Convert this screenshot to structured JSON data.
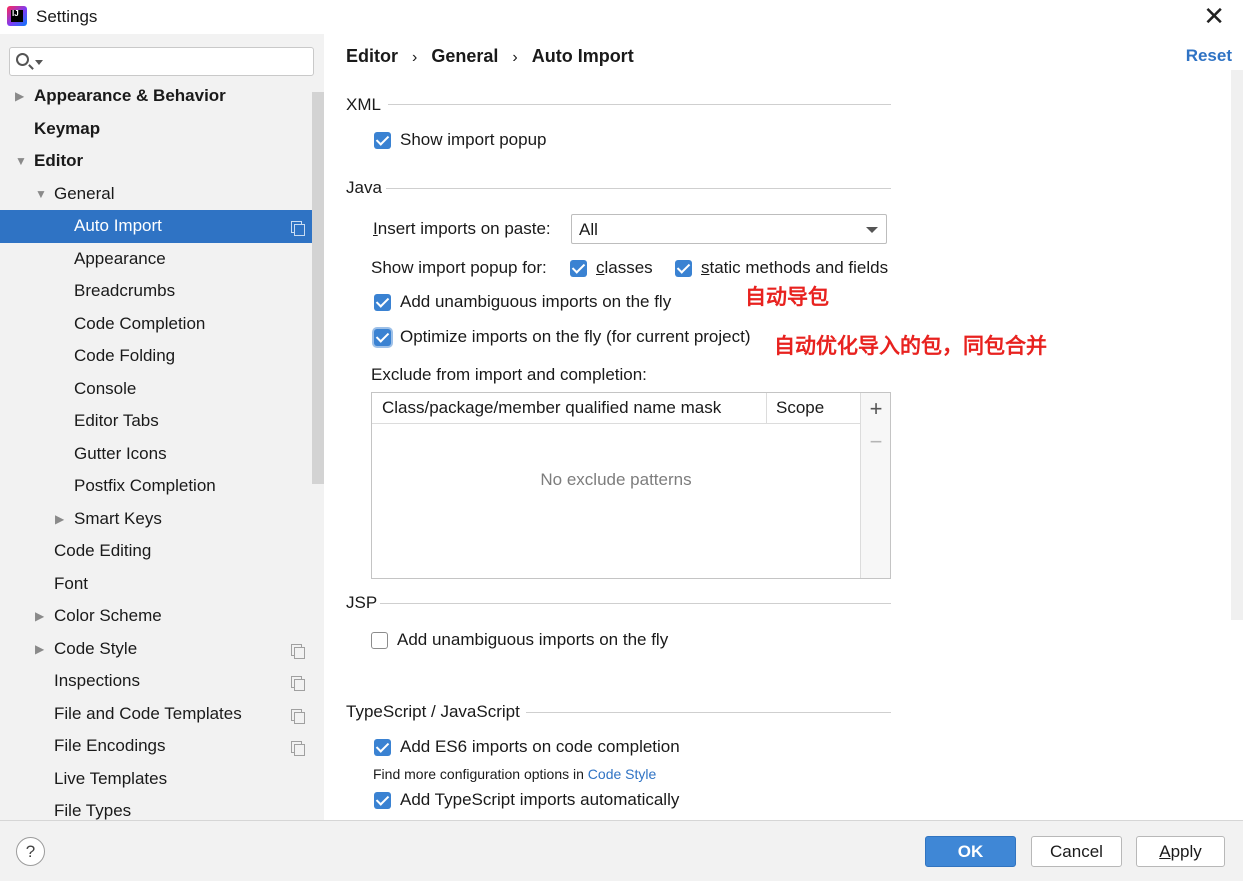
{
  "window": {
    "title": "Settings",
    "app_icon": "intellij-idea-icon",
    "close_glyph": "✕"
  },
  "search": {
    "value": "",
    "placeholder": ""
  },
  "sidebar": {
    "items": [
      {
        "label": "Appearance & Behavior",
        "level": 0,
        "arrow": "collapsed",
        "bold": true
      },
      {
        "label": "Keymap",
        "level": 0,
        "arrow": "none",
        "bold": true
      },
      {
        "label": "Editor",
        "level": 0,
        "arrow": "expanded",
        "bold": true
      },
      {
        "label": "General",
        "level": 1,
        "arrow": "expanded"
      },
      {
        "label": "Auto Import",
        "level": 2,
        "arrow": "none",
        "selected": true,
        "copy_icon": true
      },
      {
        "label": "Appearance",
        "level": 2,
        "arrow": "none"
      },
      {
        "label": "Breadcrumbs",
        "level": 2,
        "arrow": "none"
      },
      {
        "label": "Code Completion",
        "level": 2,
        "arrow": "none"
      },
      {
        "label": "Code Folding",
        "level": 2,
        "arrow": "none"
      },
      {
        "label": "Console",
        "level": 2,
        "arrow": "none"
      },
      {
        "label": "Editor Tabs",
        "level": 2,
        "arrow": "none"
      },
      {
        "label": "Gutter Icons",
        "level": 2,
        "arrow": "none"
      },
      {
        "label": "Postfix Completion",
        "level": 2,
        "arrow": "none"
      },
      {
        "label": "Smart Keys",
        "level": 2,
        "arrow": "collapsed"
      },
      {
        "label": "Code Editing",
        "level": 1,
        "arrow": "none"
      },
      {
        "label": "Font",
        "level": 1,
        "arrow": "none"
      },
      {
        "label": "Color Scheme",
        "level": 1,
        "arrow": "collapsed"
      },
      {
        "label": "Code Style",
        "level": 1,
        "arrow": "collapsed",
        "copy_icon": true
      },
      {
        "label": "Inspections",
        "level": 1,
        "arrow": "none",
        "copy_icon": true
      },
      {
        "label": "File and Code Templates",
        "level": 1,
        "arrow": "none",
        "copy_icon": true
      },
      {
        "label": "File Encodings",
        "level": 1,
        "arrow": "none",
        "copy_icon": true
      },
      {
        "label": "Live Templates",
        "level": 1,
        "arrow": "none"
      },
      {
        "label": "File Types",
        "level": 1,
        "arrow": "none"
      }
    ]
  },
  "breadcrumb": {
    "items": [
      "Editor",
      "General",
      "Auto Import"
    ],
    "separator": "›"
  },
  "reset_label": "Reset",
  "xml": {
    "title": "XML",
    "show_import_popup": {
      "label": "Show import popup",
      "checked": true
    }
  },
  "java": {
    "title": "Java",
    "insert_on_paste": {
      "label_prefix": "",
      "label_u": "I",
      "label_rest": "nsert imports on paste:",
      "value": "All"
    },
    "popup_for": {
      "label": "Show import popup for:",
      "classes": {
        "label_u": "c",
        "label_rest": "lasses",
        "checked": true
      },
      "static": {
        "label_u": "s",
        "label_rest": "tatic methods and fields",
        "checked": true
      }
    },
    "add_unambiguous": {
      "label": "Add unambiguous imports on the fly",
      "checked": true
    },
    "optimize": {
      "label": "Optimize imports on the fly (for current project)",
      "checked": true
    },
    "exclude": {
      "label": "Exclude from import and completion:",
      "columns": [
        "Class/package/member qualified name mask",
        "Scope"
      ],
      "empty_text": "No exclude patterns",
      "add_glyph": "+",
      "remove_glyph": "−"
    }
  },
  "annotations": {
    "auto_import": "自动导包",
    "optimize": "自动优化导入的包，同包合并"
  },
  "jsp": {
    "title": "JSP",
    "add_unambiguous": {
      "label": "Add unambiguous imports on the fly",
      "checked": false
    }
  },
  "ts": {
    "title": "TypeScript / JavaScript",
    "add_es6": {
      "label": "Add ES6 imports on code completion",
      "checked": true
    },
    "more_config_prefix": "Find more configuration options in ",
    "more_config_link": "Code Style",
    "add_ts_auto": {
      "label": "Add TypeScript imports automatically",
      "checked": true
    }
  },
  "footer": {
    "help_glyph": "?",
    "ok": "OK",
    "cancel": "Cancel",
    "apply_u": "A",
    "apply_rest": "pply"
  },
  "colors": {
    "accent": "#2f73c4",
    "checkbox": "#3a82d2",
    "annotation": "#e8221f"
  }
}
